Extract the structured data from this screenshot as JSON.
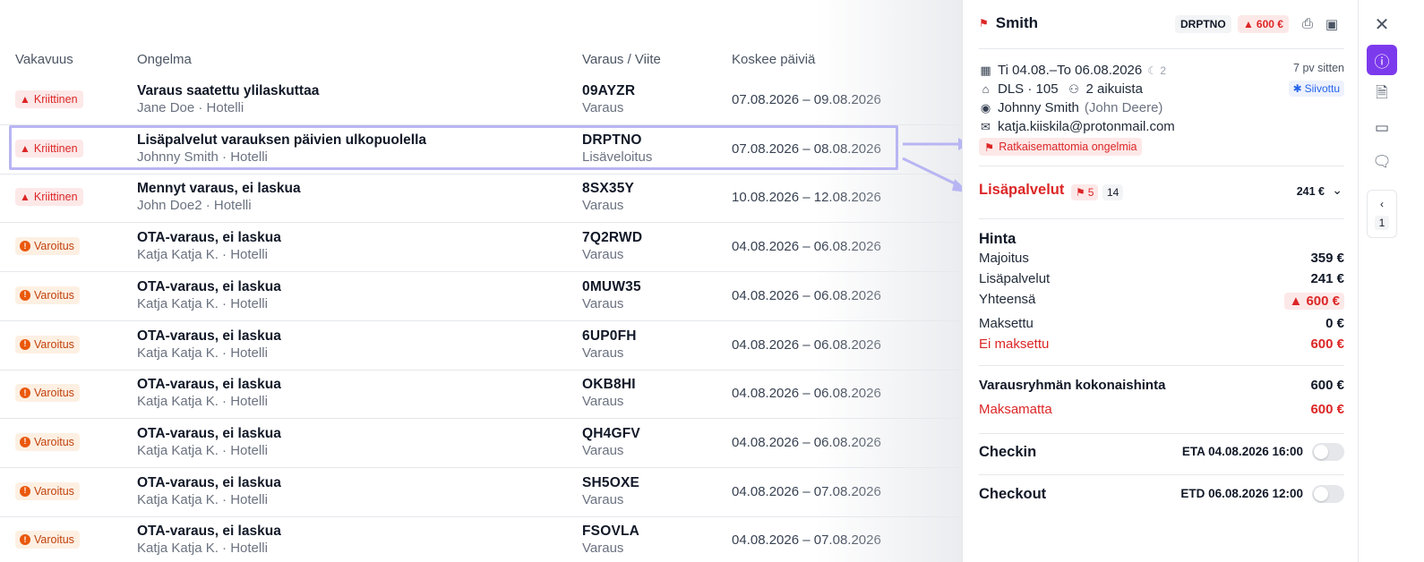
{
  "table": {
    "headers": {
      "severity": "Vakavuus",
      "problem": "Ongelma",
      "reference": "Varaus / Viite",
      "dates": "Koskee päiviä"
    },
    "rows": [
      {
        "severity": "Kriittinen",
        "level": "crit",
        "title": "Varaus saatettu ylilaskuttaa",
        "sub": "Jane Doe · Hotelli",
        "ref": "09AYZR",
        "ref_type": "Varaus",
        "dates": "07.08.2026 – 09.08.2026"
      },
      {
        "severity": "Kriittinen",
        "level": "crit",
        "title": "Lisäpalvelut varauksen päivien ulkopuolella",
        "sub": "Johnny Smith · Hotelli",
        "ref": "DRPTNO",
        "ref_type": "Lisäveloitus",
        "dates": "07.08.2026 – 08.08.2026"
      },
      {
        "severity": "Kriittinen",
        "level": "crit",
        "title": "Mennyt varaus, ei laskua",
        "sub": "John Doe2 · Hotelli",
        "ref": "8SX35Y",
        "ref_type": "Varaus",
        "dates": "10.08.2026 – 12.08.2026"
      },
      {
        "severity": "Varoitus",
        "level": "warn",
        "title": "OTA-varaus, ei laskua",
        "sub": "Katja Katja K. · Hotelli",
        "ref": "7Q2RWD",
        "ref_type": "Varaus",
        "dates": "04.08.2026 – 06.08.2026"
      },
      {
        "severity": "Varoitus",
        "level": "warn",
        "title": "OTA-varaus, ei laskua",
        "sub": "Katja Katja K. · Hotelli",
        "ref": "0MUW35",
        "ref_type": "Varaus",
        "dates": "04.08.2026 – 06.08.2026"
      },
      {
        "severity": "Varoitus",
        "level": "warn",
        "title": "OTA-varaus, ei laskua",
        "sub": "Katja Katja K. · Hotelli",
        "ref": "6UP0FH",
        "ref_type": "Varaus",
        "dates": "04.08.2026 – 06.08.2026"
      },
      {
        "severity": "Varoitus",
        "level": "warn",
        "title": "OTA-varaus, ei laskua",
        "sub": "Katja Katja K. · Hotelli",
        "ref": "OKB8HI",
        "ref_type": "Varaus",
        "dates": "04.08.2026 – 06.08.2026"
      },
      {
        "severity": "Varoitus",
        "level": "warn",
        "title": "OTA-varaus, ei laskua",
        "sub": "Katja Katja K. · Hotelli",
        "ref": "QH4GFV",
        "ref_type": "Varaus",
        "dates": "04.08.2026 – 06.08.2026"
      },
      {
        "severity": "Varoitus",
        "level": "warn",
        "title": "OTA-varaus, ei laskua",
        "sub": "Katja Katja K. · Hotelli",
        "ref": "SH5OXE",
        "ref_type": "Varaus",
        "dates": "04.08.2026 – 07.08.2026"
      },
      {
        "severity": "Varoitus",
        "level": "warn",
        "title": "OTA-varaus, ei laskua",
        "sub": "Katja Katja K. · Hotelli",
        "ref": "FSOVLA",
        "ref_type": "Varaus",
        "dates": "04.08.2026 – 07.08.2026"
      }
    ]
  },
  "panel": {
    "guest_name": "Smith",
    "ref_chip": "DRPTNO",
    "total_chip": "600 €",
    "dates": "Ti 04.08.–To 06.08.2026",
    "nights": "2",
    "ago": "7 pv sitten",
    "room": "DLS · 105",
    "guests": "2 aikuista",
    "cleaning": "Siivottu",
    "contact_name": "Johnny Smith",
    "contact_alias": "(John Deere)",
    "email": "katja.kiiskila@protonmail.com",
    "problems_chip": "Ratkaisemattomia ongelmia",
    "extras": {
      "title": "Lisäpalvelut",
      "flag_count": "5",
      "count": "14",
      "amount": "241 €"
    },
    "price": {
      "title": "Hinta",
      "accommodation_label": "Majoitus",
      "accommodation": "359 €",
      "extras_label": "Lisäpalvelut",
      "extras": "241 €",
      "total_label": "Yhteensä",
      "total": "600 €",
      "paid_label": "Maksettu",
      "paid": "0 €",
      "unpaid_label": "Ei maksettu",
      "unpaid": "600 €"
    },
    "group": {
      "total_label": "Varausryhmän kokonaishinta",
      "total": "600 €",
      "unpaid_label": "Maksamatta",
      "unpaid": "600 €"
    },
    "checkin": {
      "label": "Checkin",
      "eta": "ETA 04.08.2026 16:00"
    },
    "checkout": {
      "label": "Checkout",
      "etd": "ETD 06.08.2026 12:00"
    }
  },
  "rail": {
    "page": "1"
  },
  "colors": {
    "accent": "#7c3aed",
    "danger": "#dc2626",
    "warning": "#ea580c",
    "highlight": "#b8b5f3"
  }
}
